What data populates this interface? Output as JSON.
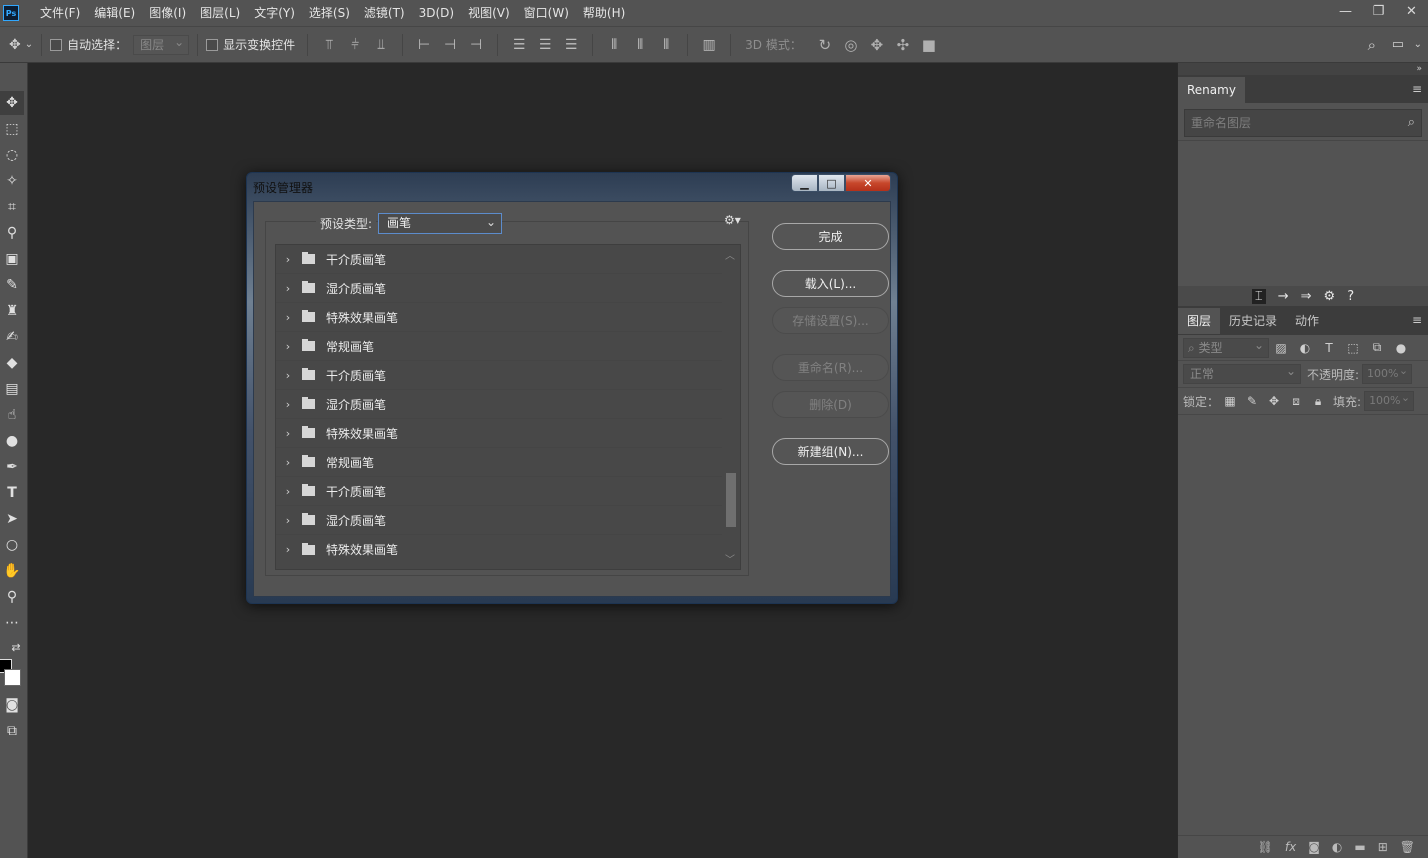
{
  "app": {
    "logo": "Ps",
    "menus": [
      "文件(F)",
      "编辑(E)",
      "图像(I)",
      "图层(L)",
      "文字(Y)",
      "选择(S)",
      "滤镜(T)",
      "3D(D)",
      "视图(V)",
      "窗口(W)",
      "帮助(H)"
    ]
  },
  "options": {
    "auto_select_label": "自动选择：",
    "auto_select_value": "图层",
    "show_transform_label": "显示变换控件",
    "mode_3d_label": "3D 模式："
  },
  "renamy": {
    "tab": "Renamy",
    "search_placeholder": "重命名图层"
  },
  "layers_panel": {
    "tabs": [
      "图层",
      "历史记录",
      "动作"
    ],
    "kind_placeholder": "类型",
    "blend_mode": "正常",
    "opacity_label": "不透明度:",
    "opacity_value": "100%",
    "lock_label": "锁定：",
    "fill_label": "填充:",
    "fill_value": "100%"
  },
  "dialog": {
    "title": "预设管理器",
    "preset_type_label": "预设类型:",
    "preset_type_value": "画笔",
    "items": [
      "干介质画笔",
      "湿介质画笔",
      "特殊效果画笔",
      "常规画笔",
      "干介质画笔",
      "湿介质画笔",
      "特殊效果画笔",
      "常规画笔",
      "干介质画笔",
      "湿介质画笔",
      "特殊效果画笔"
    ],
    "buttons": {
      "done": "完成",
      "load": "载入(L)...",
      "save": "存储设置(S)...",
      "rename": "重命名(R)...",
      "delete": "删除(D)",
      "new_group": "新建组(N)..."
    }
  },
  "colors": {
    "foreground": "#000000",
    "background": "#ffffff"
  }
}
